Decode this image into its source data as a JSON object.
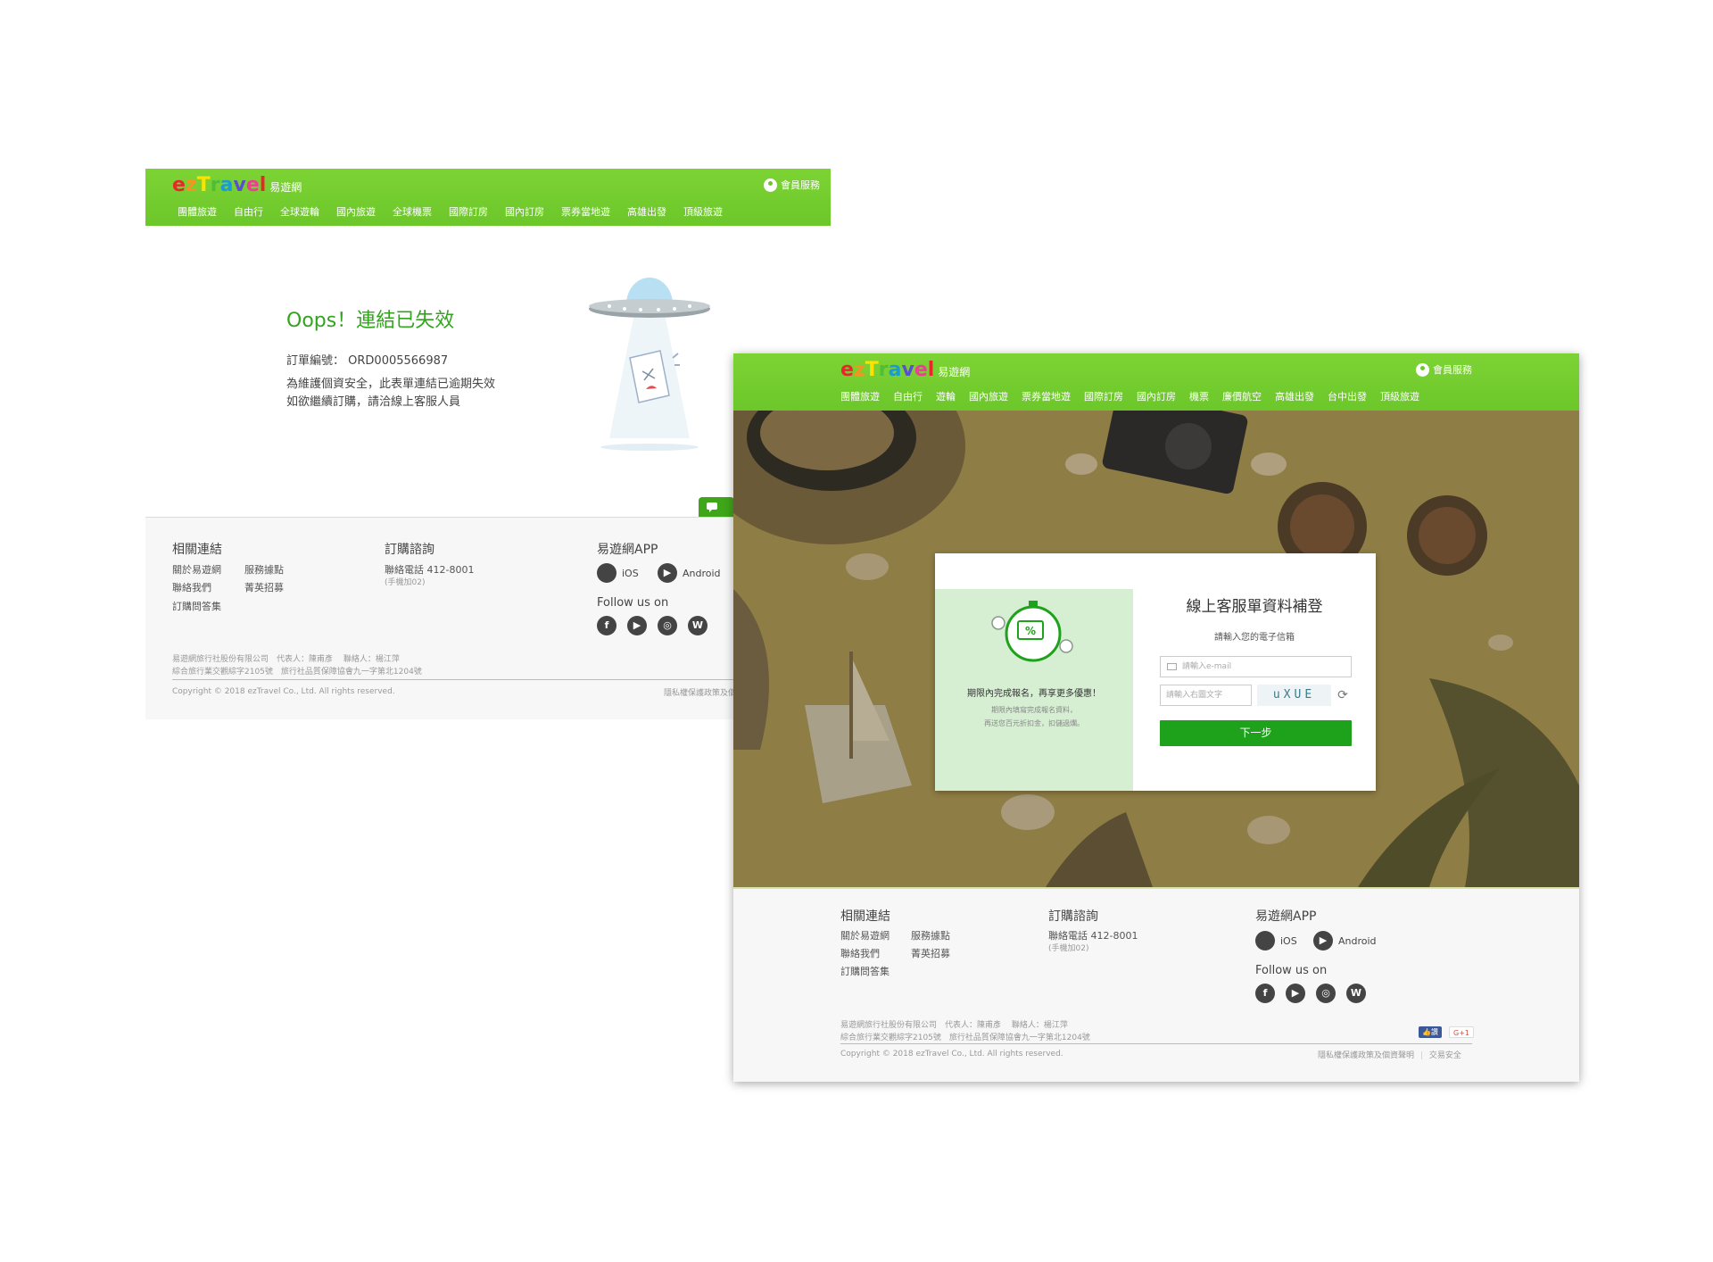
{
  "brand": {
    "logo_letters": [
      "e",
      "z",
      "T",
      "r",
      "a",
      "v",
      "e",
      "l"
    ],
    "logo_colors": [
      "#e8272c",
      "#f7931e",
      "#ffe100",
      "#4dbd3a",
      "#1b9ad6",
      "#5a4fcf",
      "#ee3d96",
      "#e8272c"
    ],
    "logo_sub": "易遊網",
    "member": "會員服務",
    "header_color": "#6cc72a"
  },
  "page1": {
    "nav": [
      "團體旅遊",
      "自由行",
      "全球遊輪",
      "國內旅遊",
      "全球機票",
      "國際訂房",
      "國內訂房",
      "票券當地遊",
      "高雄出發",
      "頂級旅遊"
    ],
    "oops_title": "Oops！連結已失效",
    "order_label": "訂單編號：",
    "order_number": "ORD0005566987",
    "msg_line1": "為維護個資安全，此表單連結已逾期失效",
    "msg_line2": "如欲繼續訂購，請洽線上客服人員"
  },
  "page2": {
    "nav": [
      "團體旅遊",
      "自由行",
      "遊輪",
      "國內旅遊",
      "票券當地遊",
      "國際訂房",
      "國內訂房",
      "機票",
      "廉價航空",
      "高雄出發",
      "台中出發",
      "頂級旅遊"
    ],
    "modal": {
      "title": "線上客服單資料補登",
      "hint": "請輸入您的電子信箱",
      "email_placeholder": "請輸入e-mail",
      "captcha_placeholder": "請輸入右圖文字",
      "captcha_text": "uXUE",
      "next_button": "下一步",
      "promo_title": "期限內完成報名，再享更多優惠！",
      "promo_line1": "期限內填寫完成報名資料，",
      "promo_line2": "再送您百元折扣金，扣儲過爛。",
      "promo_icon_text": "%"
    },
    "badges": {
      "like": "讚",
      "gplus": "G+1"
    },
    "policy_extra": "交易安全"
  },
  "footer": {
    "links_title": "相關連結",
    "links": [
      "關於易遊網",
      "服務據點",
      "聯絡我們",
      "菁英招募",
      "訂購問答集"
    ],
    "order_title": "訂購諮詢",
    "phone": "聯絡電話 412-8001",
    "phone_note": "(手機加02)",
    "app_title": "易遊網APP",
    "ios": "iOS",
    "android": "Android",
    "follow": "Follow us on",
    "company_line1": "易遊網旅行社股份有限公司　代表人：陳甫彥　 聯絡人：楊江萍",
    "company_line2": "綜合旅行業交觀綜字2105號　旅行社品質保障協會九一字第北1204號",
    "copyright": "Copyright © 2018 ezTravel Co., Ltd. All rights reserved.",
    "policy": "隱私權保護政策及個資聲明"
  }
}
